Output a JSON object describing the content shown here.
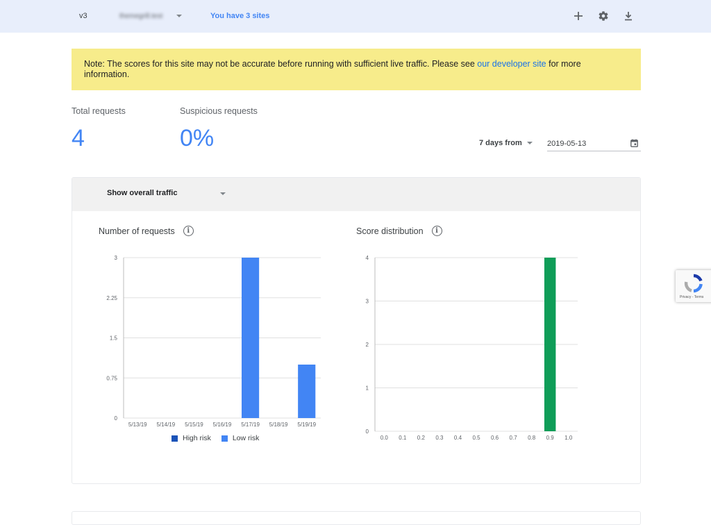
{
  "topbar": {
    "version": "v3",
    "site_name": "themegrill.test",
    "sites_link": "You have 3 sites",
    "icons": [
      "plus-icon",
      "gear-icon",
      "download-icon"
    ]
  },
  "note": {
    "text_before": "Note: The scores for this site may not be accurate before running with sufficient live traffic. Please see ",
    "link_text": "our developer site",
    "text_after": " for more information."
  },
  "stats": {
    "total_label": "Total requests",
    "total_value": "4",
    "suspicious_label": "Suspicious requests",
    "suspicious_value": "0%"
  },
  "filters": {
    "range_label": "7 days from",
    "date_value": "2019-05-13"
  },
  "traffic": {
    "select_label": "Show overall traffic"
  },
  "colors": {
    "high_risk": "#1a53b8",
    "low_risk": "#4285f4",
    "score_bar": "#0f9d58",
    "accent": "#4285f4",
    "note_bg": "#f7ec8b"
  },
  "chart_data": [
    {
      "type": "bar",
      "title": "Number of requests",
      "categories": [
        "5/13/19",
        "5/14/19",
        "5/15/19",
        "5/16/19",
        "5/17/19",
        "5/18/19",
        "5/19/19"
      ],
      "series": [
        {
          "name": "High risk",
          "values": [
            0,
            0,
            0,
            0,
            0,
            0,
            0
          ]
        },
        {
          "name": "Low risk",
          "values": [
            0,
            0,
            0,
            0,
            3,
            0,
            1
          ]
        }
      ],
      "yticks": [
        "0",
        "0.75",
        "1.5",
        "2.25",
        "3"
      ],
      "ylim": [
        0,
        3
      ],
      "grid": true,
      "legend": "bottom"
    },
    {
      "type": "bar",
      "title": "Score distribution",
      "categories": [
        "0.0",
        "0.1",
        "0.2",
        "0.3",
        "0.4",
        "0.5",
        "0.6",
        "0.7",
        "0.8",
        "0.9",
        "1.0"
      ],
      "values": [
        0,
        0,
        0,
        0,
        0,
        0,
        0,
        0,
        0,
        4,
        0
      ],
      "yticks": [
        "0",
        "1",
        "2",
        "3",
        "4"
      ],
      "ylim": [
        0,
        4
      ],
      "grid": true
    }
  ],
  "recaptcha": {
    "links": "Privacy - Terms"
  }
}
